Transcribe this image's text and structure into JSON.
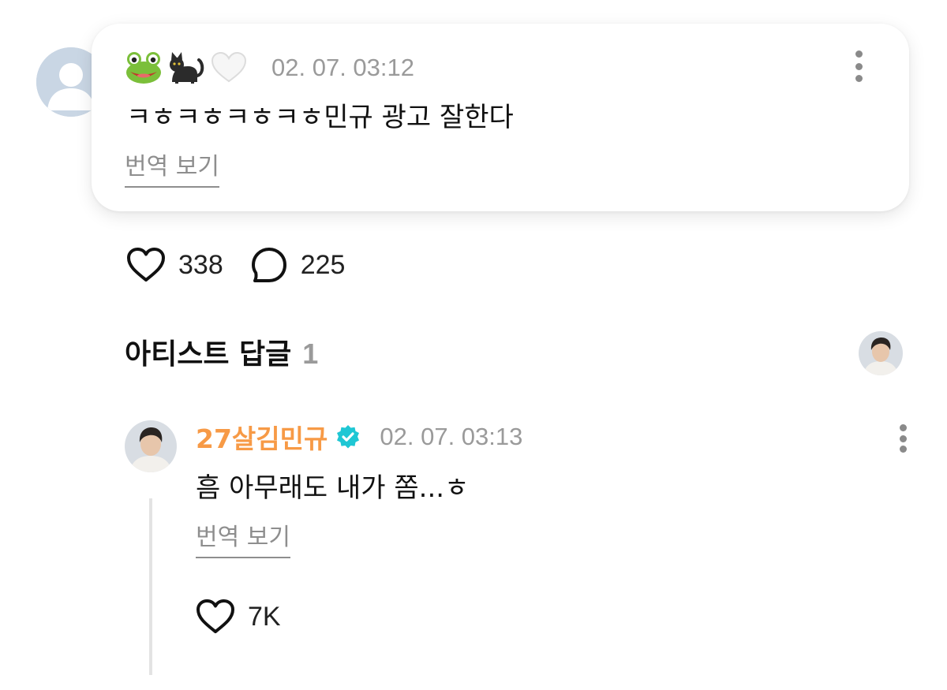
{
  "comment": {
    "author_emoji": [
      "frog",
      "black-cat",
      "white-heart"
    ],
    "timestamp": "02. 07. 03:12",
    "text": "ㅋㅎㅋㅎㅋㅎㅋㅎ민규 광고 잘한다",
    "translate_label": "번역 보기",
    "likes": "338",
    "replies": "225"
  },
  "artist_section": {
    "title": "아티스트 답글",
    "count": "1"
  },
  "reply": {
    "author": "27살김민규",
    "author_color": "#f79a46",
    "verified_color": "#1fc7d4",
    "timestamp": "02. 07. 03:13",
    "text": "흠 아무래도 내가 쫌...ㅎ",
    "translate_label": "번역 보기",
    "likes": "7K"
  }
}
